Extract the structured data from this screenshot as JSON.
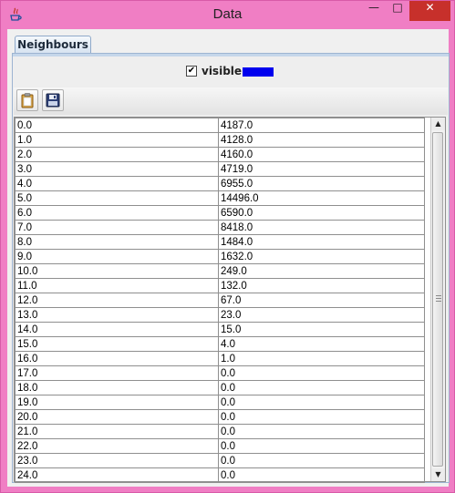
{
  "window": {
    "title": "Data",
    "controls": {
      "minimize": "—",
      "maximize": "□",
      "close": "✕"
    },
    "frame_color": "#f07ec4"
  },
  "tabs": [
    {
      "label": "Neighbours",
      "selected": true
    }
  ],
  "visibility": {
    "checked": true,
    "check_glyph": "✔",
    "label": "visible",
    "color": "#0000ee"
  },
  "toolbar": {
    "buttons": [
      {
        "icon": "clipboard-icon"
      },
      {
        "icon": "save-disk-icon"
      }
    ]
  },
  "table": {
    "rows": [
      [
        "0.0",
        "4187.0"
      ],
      [
        "1.0",
        "4128.0"
      ],
      [
        "2.0",
        "4160.0"
      ],
      [
        "3.0",
        "4719.0"
      ],
      [
        "4.0",
        "6955.0"
      ],
      [
        "5.0",
        "14496.0"
      ],
      [
        "6.0",
        "6590.0"
      ],
      [
        "7.0",
        "8418.0"
      ],
      [
        "8.0",
        "1484.0"
      ],
      [
        "9.0",
        "1632.0"
      ],
      [
        "10.0",
        "249.0"
      ],
      [
        "11.0",
        "132.0"
      ],
      [
        "12.0",
        "67.0"
      ],
      [
        "13.0",
        "23.0"
      ],
      [
        "14.0",
        "15.0"
      ],
      [
        "15.0",
        "4.0"
      ],
      [
        "16.0",
        "1.0"
      ],
      [
        "17.0",
        "0.0"
      ],
      [
        "18.0",
        "0.0"
      ],
      [
        "19.0",
        "0.0"
      ],
      [
        "20.0",
        "0.0"
      ],
      [
        "21.0",
        "0.0"
      ],
      [
        "22.0",
        "0.0"
      ],
      [
        "23.0",
        "0.0"
      ],
      [
        "24.0",
        "0.0"
      ]
    ]
  },
  "scrollbar": {
    "up": "▲",
    "down": "▼"
  }
}
